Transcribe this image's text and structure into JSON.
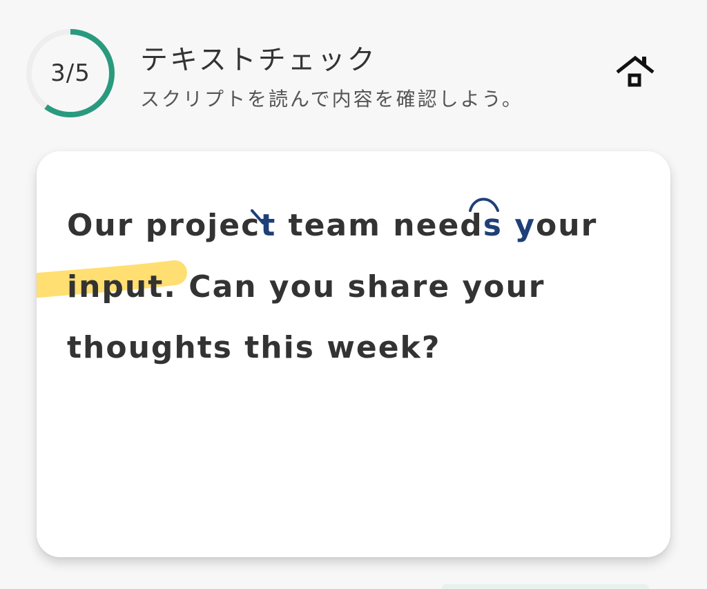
{
  "header": {
    "progress_label": "3/5",
    "progress_current": 3,
    "progress_total": 5,
    "title": "テキストチェック",
    "subtitle": "スクリプトを読んで内容を確認しよう。",
    "home_icon": "home-icon"
  },
  "script": {
    "line1_pre": "Our projec",
    "line1_mark_t": "t",
    "line1_mid": " team need",
    "line1_mark_s": "s",
    "line1_space": " ",
    "line1_mark_y": "y",
    "line1_post": "our",
    "line2_highlight": "input.",
    "line2_post": " Can you share your",
    "line3": "thoughts this week?"
  },
  "colors": {
    "accent": "#2a9a7e",
    "ring_track": "#eeeeee",
    "annotation_blue": "#1f3f78",
    "highlight_yellow": "#ffd54a"
  }
}
